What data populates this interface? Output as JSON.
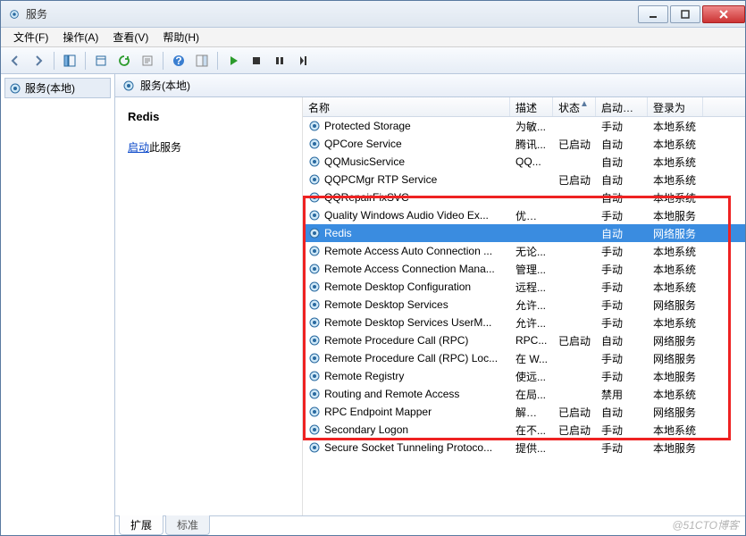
{
  "window": {
    "title": "服务"
  },
  "menu": {
    "file": "文件(F)",
    "action": "操作(A)",
    "view": "查看(V)",
    "help": "帮助(H)"
  },
  "tree": {
    "root": "服务(本地)"
  },
  "main": {
    "heading": "服务(本地)"
  },
  "details": {
    "selected_service": "Redis",
    "start_link": "启动",
    "start_suffix": "此服务"
  },
  "columns": {
    "name": "名称",
    "desc": "描述",
    "status": "状态",
    "startup": "启动类型",
    "logon": "登录为"
  },
  "services": [
    {
      "name": "Protected Storage",
      "desc": "为敏...",
      "status": "",
      "startup": "手动",
      "logon": "本地系统"
    },
    {
      "name": "QPCore Service",
      "desc": "腾讯...",
      "status": "已启动",
      "startup": "自动",
      "logon": "本地系统"
    },
    {
      "name": "QQMusicService",
      "desc": "QQ...",
      "status": "",
      "startup": "自动",
      "logon": "本地系统"
    },
    {
      "name": "QQPCMgr RTP Service",
      "desc": "",
      "status": "已启动",
      "startup": "自动",
      "logon": "本地系统"
    },
    {
      "name": "QQRepairFixSVC",
      "desc": "",
      "status": "",
      "startup": "自动",
      "logon": "本地系统"
    },
    {
      "name": "Quality Windows Audio Video Ex...",
      "desc": "优质 ...",
      "status": "",
      "startup": "手动",
      "logon": "本地服务"
    },
    {
      "name": "Redis",
      "desc": "",
      "status": "",
      "startup": "自动",
      "logon": "网络服务",
      "selected": true
    },
    {
      "name": "Remote Access Auto Connection ...",
      "desc": "无论...",
      "status": "",
      "startup": "手动",
      "logon": "本地系统"
    },
    {
      "name": "Remote Access Connection Mana...",
      "desc": "管理...",
      "status": "",
      "startup": "手动",
      "logon": "本地系统"
    },
    {
      "name": "Remote Desktop Configuration",
      "desc": "远程...",
      "status": "",
      "startup": "手动",
      "logon": "本地系统"
    },
    {
      "name": "Remote Desktop Services",
      "desc": "允许...",
      "status": "",
      "startup": "手动",
      "logon": "网络服务"
    },
    {
      "name": "Remote Desktop Services UserM...",
      "desc": "允许...",
      "status": "",
      "startup": "手动",
      "logon": "本地系统"
    },
    {
      "name": "Remote Procedure Call (RPC)",
      "desc": "RPC...",
      "status": "已启动",
      "startup": "自动",
      "logon": "网络服务"
    },
    {
      "name": "Remote Procedure Call (RPC) Loc...",
      "desc": "在 W...",
      "status": "",
      "startup": "手动",
      "logon": "网络服务"
    },
    {
      "name": "Remote Registry",
      "desc": "使远...",
      "status": "",
      "startup": "手动",
      "logon": "本地服务"
    },
    {
      "name": "Routing and Remote Access",
      "desc": "在局...",
      "status": "",
      "startup": "禁用",
      "logon": "本地系统"
    },
    {
      "name": "RPC Endpoint Mapper",
      "desc": "解析 ...",
      "status": "已启动",
      "startup": "自动",
      "logon": "网络服务"
    },
    {
      "name": "Secondary Logon",
      "desc": "在不...",
      "status": "已启动",
      "startup": "手动",
      "logon": "本地系统"
    },
    {
      "name": "Secure Socket Tunneling Protoco...",
      "desc": "提供...",
      "status": "",
      "startup": "手动",
      "logon": "本地服务"
    }
  ],
  "tabs": {
    "extended": "扩展",
    "standard": "标准"
  },
  "watermark": "@51CTO博客"
}
